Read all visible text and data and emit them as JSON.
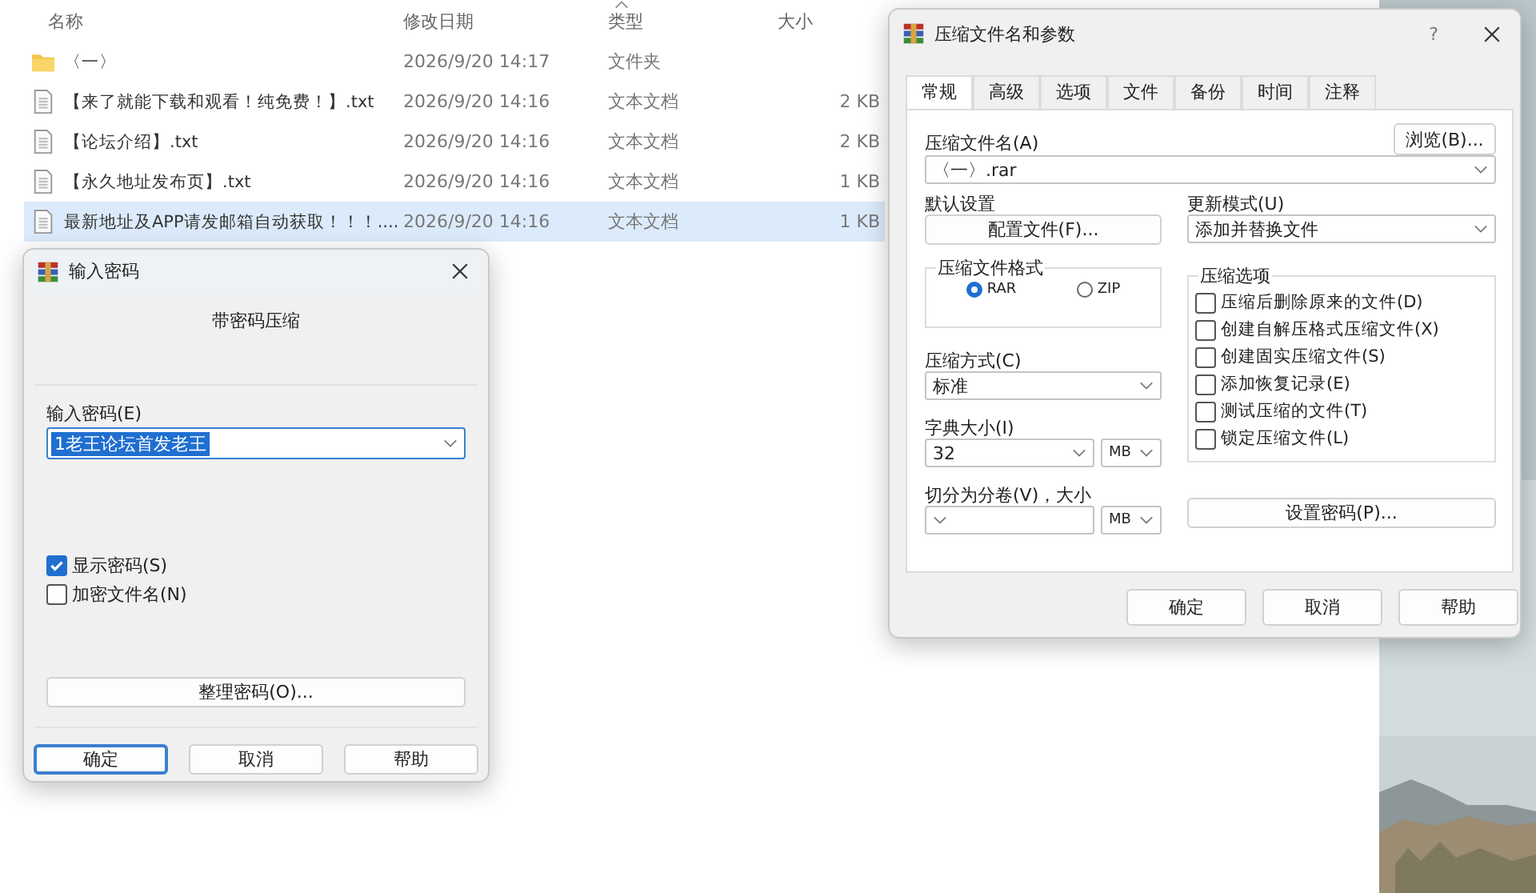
{
  "explorer": {
    "columns": [
      {
        "label": "名称",
        "sorted": false
      },
      {
        "label": "修改日期",
        "sorted": false
      },
      {
        "label": "类型",
        "sorted": true
      },
      {
        "label": "大小",
        "sorted": false
      }
    ],
    "rows": [
      {
        "kind": "folder",
        "name": "〈一〉",
        "date": "2026/9/20 14:17",
        "type": "文件夹",
        "selected": false
      },
      {
        "kind": "text",
        "name": "【来了就能下载和观看！纯免费！】.txt",
        "date": "2026/9/20 14:16",
        "type": "文本文档",
        "size": "2 KB",
        "selected": false
      },
      {
        "kind": "text",
        "name": "【论坛介绍】.txt",
        "date": "2026/9/20 14:16",
        "type": "文本文档",
        "size": "2 KB",
        "selected": false
      },
      {
        "kind": "text",
        "name": "【永久地址发布页】.txt",
        "date": "2026/9/20 14:16",
        "type": "文本文档",
        "size": "1 KB",
        "selected": false
      },
      {
        "kind": "text",
        "name": "最新地址及APP请发邮箱自动获取！！！....",
        "date": "2026/9/20 14:16",
        "type": "文本文档",
        "size": "1 KB",
        "selected": true
      }
    ]
  },
  "password_dialog": {
    "title": "输入密码",
    "subtitle": "带密码压缩",
    "password_label": "输入密码(E)",
    "password_value": "1老王论坛首发老王",
    "checkboxes": [
      {
        "label": "显示密码(S)",
        "checked": true
      },
      {
        "label": "加密文件名(N)",
        "checked": false
      }
    ],
    "manage_button": "整理密码(O)...",
    "buttons": [
      {
        "label": "确定",
        "default": true
      },
      {
        "label": "取消",
        "default": false
      },
      {
        "label": "帮助",
        "default": false
      }
    ]
  },
  "archive_dialog": {
    "title": "压缩文件名和参数",
    "help": "?",
    "tabs": [
      {
        "label": "常规",
        "selected": true
      },
      {
        "label": "高级",
        "selected": false
      },
      {
        "label": "选项",
        "selected": false
      },
      {
        "label": "文件",
        "selected": false
      },
      {
        "label": "备份",
        "selected": false
      },
      {
        "label": "时间",
        "selected": false
      },
      {
        "label": "注释",
        "selected": false
      }
    ],
    "archive_name_label": "压缩文件名(A)",
    "browse_button": "浏览(B)...",
    "archive_name": "〈一〉.rar",
    "profile_label": "默认设置",
    "profile_button": "配置文件(F)...",
    "update_label": "更新模式(U)",
    "update_value": "添加并替换文件",
    "format_label": "压缩文件格式",
    "formats": [
      {
        "label": "RAR",
        "selected": true
      },
      {
        "label": "ZIP",
        "selected": false
      }
    ],
    "method_label": "压缩方式(C)",
    "method_value": "标准",
    "dict_label": "字典大小(I)",
    "dict_value": "32",
    "dict_unit": "MB",
    "split_label": "切分为分卷(V)，大小",
    "split_unit": "MB",
    "options_label": "压缩选项",
    "options": [
      {
        "label": "压缩后删除原来的文件(D)",
        "checked": false
      },
      {
        "label": "创建自解压格式压缩文件(X)",
        "checked": false
      },
      {
        "label": "创建固实压缩文件(S)",
        "checked": false
      },
      {
        "label": "添加恢复记录(E)",
        "checked": false
      },
      {
        "label": "测试压缩的文件(T)",
        "checked": false
      },
      {
        "label": "锁定压缩文件(L)",
        "checked": false
      }
    ],
    "password_button": "设置密码(P)...",
    "buttons": [
      {
        "label": "确定"
      },
      {
        "label": "取消"
      },
      {
        "label": "帮助"
      }
    ]
  }
}
